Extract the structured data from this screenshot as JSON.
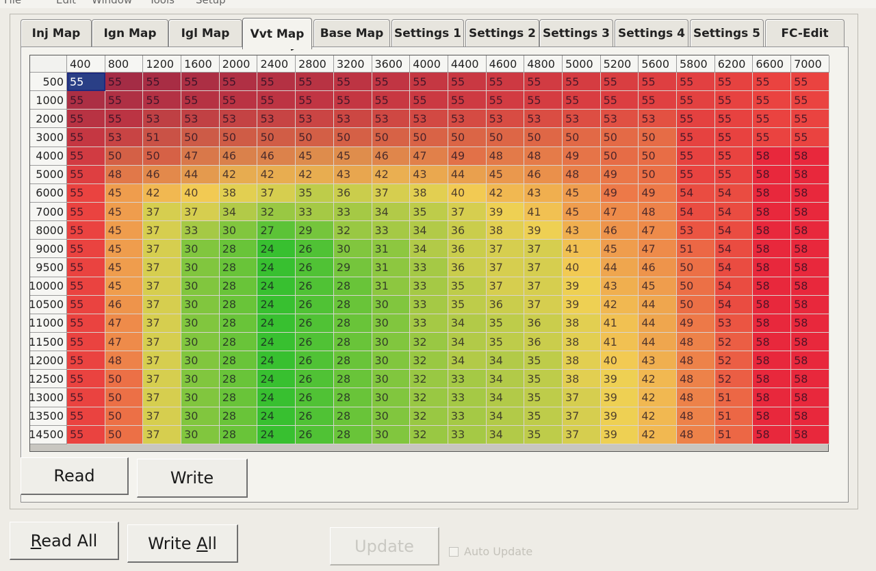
{
  "menubar": {
    "items": [
      "File",
      "Edit",
      "Window",
      "Tools",
      "Setup"
    ]
  },
  "tabs": [
    {
      "label": "Inj Map",
      "active": false
    },
    {
      "label": "Ign Map",
      "active": false
    },
    {
      "label": "Igl Map",
      "active": false
    },
    {
      "label": "Vvt Map",
      "active": true
    },
    {
      "label": "Base Map",
      "active": false
    },
    {
      "label": "Settings 1",
      "active": false
    },
    {
      "label": "Settings 2",
      "active": false
    },
    {
      "label": "Settings 3",
      "active": false
    },
    {
      "label": "Settings 4",
      "active": false
    },
    {
      "label": "Settings 5",
      "active": false
    },
    {
      "label": "FC-Edit",
      "active": false
    }
  ],
  "table": {
    "columns": [
      "400",
      "800",
      "1200",
      "1600",
      "2000",
      "2400",
      "2800",
      "3200",
      "3600",
      "4000",
      "4400",
      "4600",
      "4800",
      "5000",
      "5200",
      "5600",
      "5800",
      "6200",
      "6600",
      "7000"
    ],
    "rows": [
      {
        "label": "500",
        "values": [
          55,
          55,
          55,
          55,
          55,
          55,
          55,
          55,
          55,
          55,
          55,
          55,
          55,
          55,
          55,
          55,
          55,
          55,
          55,
          55
        ]
      },
      {
        "label": "1000",
        "values": [
          55,
          55,
          55,
          55,
          55,
          55,
          55,
          55,
          55,
          55,
          55,
          55,
          55,
          55,
          55,
          55,
          55,
          55,
          55,
          55
        ]
      },
      {
        "label": "2000",
        "values": [
          55,
          55,
          53,
          53,
          53,
          53,
          53,
          53,
          53,
          53,
          53,
          53,
          53,
          53,
          53,
          53,
          55,
          55,
          55,
          55
        ]
      },
      {
        "label": "3000",
        "values": [
          55,
          53,
          51,
          50,
          50,
          50,
          50,
          50,
          50,
          50,
          50,
          50,
          50,
          50,
          50,
          50,
          55,
          55,
          55,
          55
        ]
      },
      {
        "label": "4000",
        "values": [
          55,
          50,
          50,
          47,
          46,
          46,
          45,
          45,
          46,
          47,
          49,
          48,
          48,
          49,
          50,
          50,
          55,
          55,
          58,
          58
        ]
      },
      {
        "label": "5000",
        "values": [
          55,
          48,
          46,
          44,
          42,
          42,
          42,
          43,
          42,
          43,
          44,
          45,
          46,
          48,
          49,
          50,
          55,
          55,
          58,
          58
        ]
      },
      {
        "label": "6000",
        "values": [
          55,
          45,
          42,
          40,
          38,
          37,
          35,
          36,
          37,
          38,
          40,
          42,
          43,
          45,
          49,
          49,
          54,
          54,
          58,
          58
        ]
      },
      {
        "label": "7000",
        "values": [
          55,
          45,
          37,
          37,
          34,
          32,
          33,
          33,
          34,
          35,
          37,
          39,
          41,
          45,
          47,
          48,
          54,
          54,
          58,
          58
        ]
      },
      {
        "label": "8000",
        "values": [
          55,
          45,
          37,
          33,
          30,
          27,
          29,
          32,
          33,
          34,
          36,
          38,
          39,
          43,
          46,
          47,
          53,
          54,
          58,
          58
        ]
      },
      {
        "label": "9000",
        "values": [
          55,
          45,
          37,
          30,
          28,
          24,
          26,
          30,
          31,
          34,
          36,
          37,
          37,
          41,
          45,
          47,
          51,
          54,
          58,
          58
        ]
      },
      {
        "label": "9500",
        "values": [
          55,
          45,
          37,
          30,
          28,
          24,
          26,
          29,
          31,
          33,
          36,
          37,
          37,
          40,
          44,
          46,
          50,
          54,
          58,
          58
        ]
      },
      {
        "label": "10000",
        "values": [
          55,
          45,
          37,
          30,
          28,
          24,
          26,
          28,
          31,
          33,
          35,
          37,
          37,
          39,
          43,
          45,
          50,
          54,
          58,
          58
        ]
      },
      {
        "label": "10500",
        "values": [
          55,
          46,
          37,
          30,
          28,
          24,
          26,
          28,
          30,
          33,
          35,
          36,
          37,
          39,
          42,
          44,
          50,
          54,
          58,
          58
        ]
      },
      {
        "label": "11000",
        "values": [
          55,
          47,
          37,
          30,
          28,
          24,
          26,
          28,
          30,
          33,
          34,
          35,
          36,
          38,
          41,
          44,
          49,
          53,
          58,
          58
        ]
      },
      {
        "label": "11500",
        "values": [
          55,
          47,
          37,
          30,
          28,
          24,
          26,
          28,
          30,
          32,
          34,
          35,
          36,
          38,
          41,
          44,
          48,
          52,
          58,
          58
        ]
      },
      {
        "label": "12000",
        "values": [
          55,
          48,
          37,
          30,
          28,
          24,
          26,
          28,
          30,
          32,
          34,
          34,
          35,
          38,
          40,
          43,
          48,
          52,
          58,
          58
        ]
      },
      {
        "label": "12500",
        "values": [
          55,
          50,
          37,
          30,
          28,
          24,
          26,
          28,
          30,
          32,
          33,
          34,
          35,
          38,
          39,
          42,
          48,
          52,
          58,
          58
        ]
      },
      {
        "label": "13000",
        "values": [
          55,
          50,
          37,
          30,
          28,
          24,
          26,
          28,
          30,
          32,
          33,
          34,
          35,
          37,
          39,
          42,
          48,
          51,
          58,
          58
        ]
      },
      {
        "label": "13500",
        "values": [
          55,
          50,
          37,
          30,
          28,
          24,
          26,
          28,
          30,
          32,
          33,
          34,
          35,
          37,
          39,
          42,
          48,
          51,
          58,
          58
        ]
      },
      {
        "label": "14500",
        "values": [
          55,
          50,
          37,
          30,
          28,
          24,
          26,
          28,
          30,
          32,
          33,
          34,
          35,
          37,
          39,
          42,
          48,
          51,
          58,
          58
        ]
      }
    ],
    "selected_cell": {
      "row": 0,
      "col": 0
    }
  },
  "colors": {
    "selected_cell": "#2a3f86",
    "low": "#38c030",
    "mid": "#f2d054",
    "high": "#e8283c",
    "deep": "#6e1a48"
  },
  "buttons": {
    "read": "Read",
    "write": "Write",
    "read_all_mnemonic": "R",
    "read_all_rest": "ead All",
    "write_all_pre": "Write ",
    "write_all_mnemonic": "A",
    "write_all_post": "ll",
    "update": "Update"
  },
  "auto_update": {
    "label": "Auto Update",
    "checked": false
  }
}
